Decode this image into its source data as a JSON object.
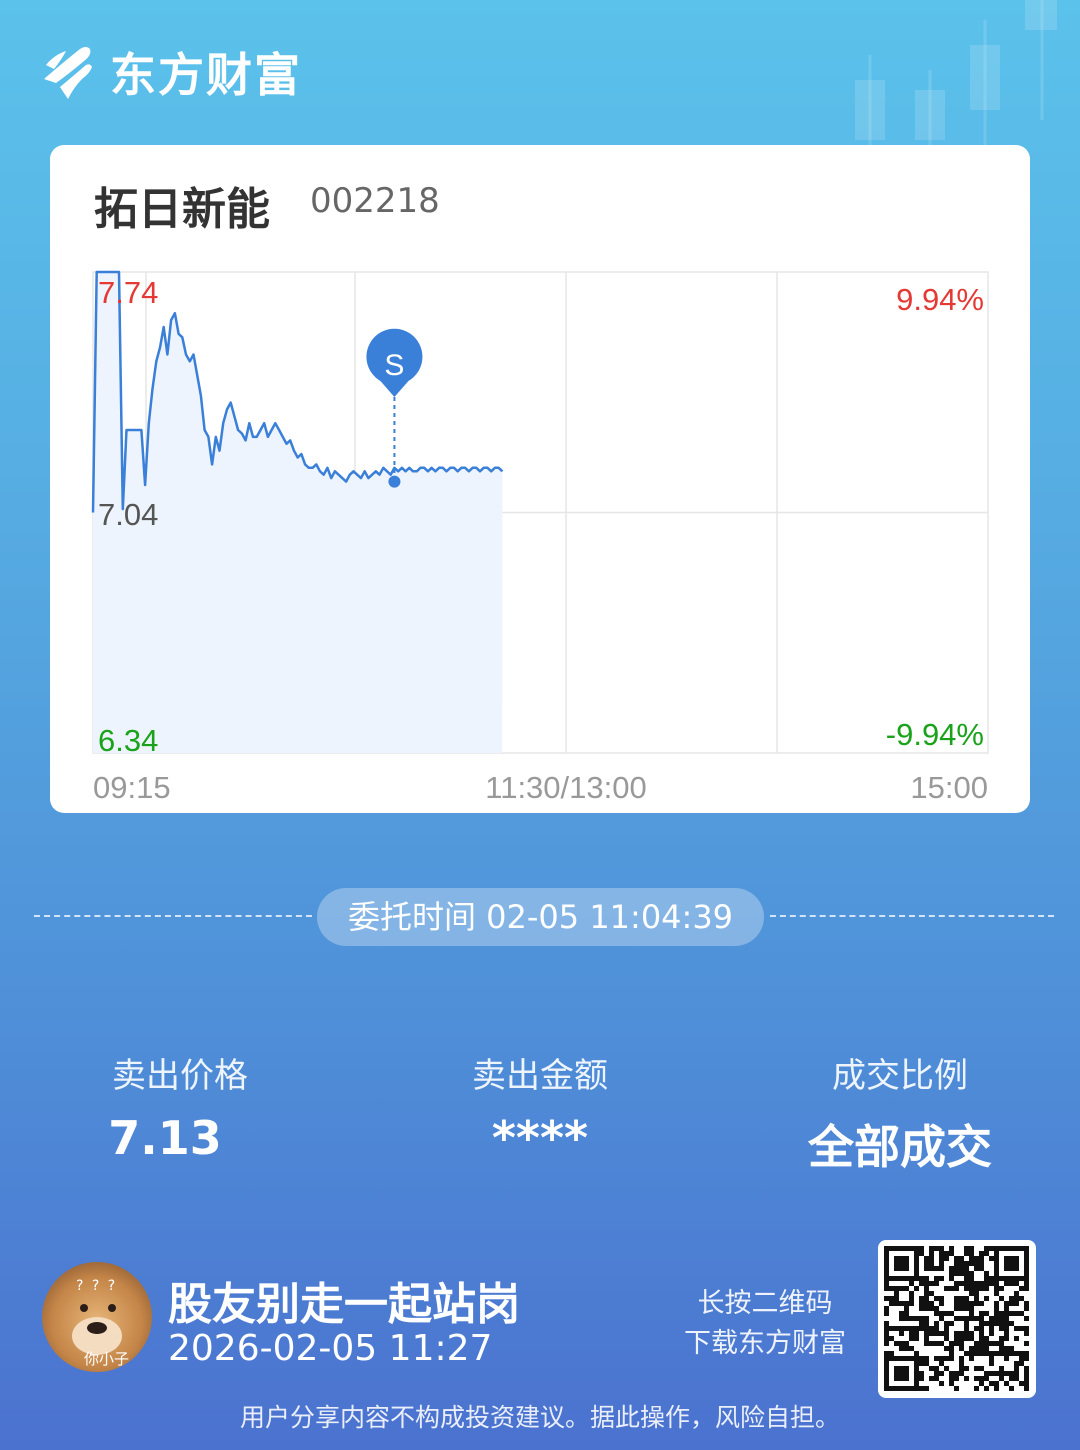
{
  "brand": {
    "name": "东方财富"
  },
  "stock": {
    "name": "拓日新能",
    "code": "002218"
  },
  "chart_data": {
    "type": "line",
    "x_ticks": [
      "09:15",
      "11:30/13:00",
      "15:00"
    ],
    "y_labels_left": [
      "7.74",
      "7.04",
      "6.34"
    ],
    "y_labels_right": [
      "9.94%",
      "-9.94%"
    ],
    "ylim": [
      6.34,
      7.74
    ],
    "prev_close": 7.04,
    "series": [
      {
        "x": [
          0,
          2,
          4,
          6,
          8,
          10,
          12,
          14,
          16,
          18,
          20,
          22,
          24,
          26,
          28,
          30,
          32,
          34,
          36,
          38,
          40,
          42,
          44,
          46,
          48,
          50,
          52,
          54,
          56,
          58,
          60,
          62,
          64,
          66,
          68,
          70,
          72,
          74,
          76,
          78,
          80,
          82,
          84,
          86,
          88,
          90,
          92,
          94,
          96,
          98,
          100,
          102,
          104,
          106,
          108,
          110,
          112,
          114,
          116,
          118,
          120,
          122,
          124,
          126,
          128,
          130,
          132,
          134,
          136,
          138,
          140,
          142,
          144,
          146,
          148,
          150,
          152,
          154,
          156,
          158,
          160,
          162,
          164,
          166,
          168,
          170,
          172,
          174,
          176,
          178,
          180,
          182,
          184,
          186,
          188,
          190,
          192,
          194,
          196,
          198,
          200,
          202,
          204,
          206,
          208,
          210,
          212,
          214,
          216,
          218,
          220
        ],
        "values": [
          7.04,
          7.74,
          7.74,
          7.74,
          7.74,
          7.74,
          7.74,
          7.74,
          7.05,
          7.28,
          7.28,
          7.28,
          7.28,
          7.28,
          7.12,
          7.3,
          7.4,
          7.48,
          7.52,
          7.58,
          7.5,
          7.6,
          7.62,
          7.56,
          7.55,
          7.5,
          7.48,
          7.5,
          7.44,
          7.38,
          7.28,
          7.26,
          7.18,
          7.26,
          7.22,
          7.3,
          7.34,
          7.36,
          7.32,
          7.28,
          7.27,
          7.25,
          7.3,
          7.26,
          7.26,
          7.28,
          7.3,
          7.26,
          7.28,
          7.3,
          7.28,
          7.26,
          7.24,
          7.25,
          7.22,
          7.2,
          7.21,
          7.18,
          7.17,
          7.17,
          7.18,
          7.16,
          7.15,
          7.17,
          7.14,
          7.16,
          7.15,
          7.14,
          7.13,
          7.15,
          7.16,
          7.15,
          7.14,
          7.16,
          7.14,
          7.15,
          7.16,
          7.15,
          7.17,
          7.16,
          7.15,
          7.17,
          7.16,
          7.17,
          7.16,
          7.17,
          7.16,
          7.16,
          7.17,
          7.17,
          7.16,
          7.17,
          7.16,
          7.17,
          7.17,
          7.16,
          7.17,
          7.17,
          7.16,
          7.17,
          7.17,
          7.16,
          7.17,
          7.17,
          7.16,
          7.17,
          7.17,
          7.16,
          7.17,
          7.17,
          7.16
        ]
      }
    ],
    "marker": {
      "label": "S",
      "index": 162,
      "value": 7.13
    },
    "colors": {
      "line": "#3a7fd8",
      "fill": "#eef4fd",
      "up": "#e53935",
      "down": "#1aa31a",
      "grid": "#e6e6e6",
      "axis_text": "#999999"
    }
  },
  "order_time": {
    "label": "委托时间",
    "value": "02-05 11:04:39"
  },
  "stats": [
    {
      "label": "卖出价格",
      "value": "7.13"
    },
    {
      "label": "卖出金额",
      "value": "****"
    },
    {
      "label": "成交比例",
      "value": "全部成交"
    }
  ],
  "user": {
    "name": "股友别走一起站岗",
    "time": "2026-02-05 11:27",
    "avatar_caption": "你小子",
    "avatar_marks": "? ? ?"
  },
  "qr_hint": {
    "line1": "长按二维码",
    "line2": "下载东方财富"
  },
  "disclaimer": "用户分享内容不构成投资建议。据此操作，风险自担。"
}
